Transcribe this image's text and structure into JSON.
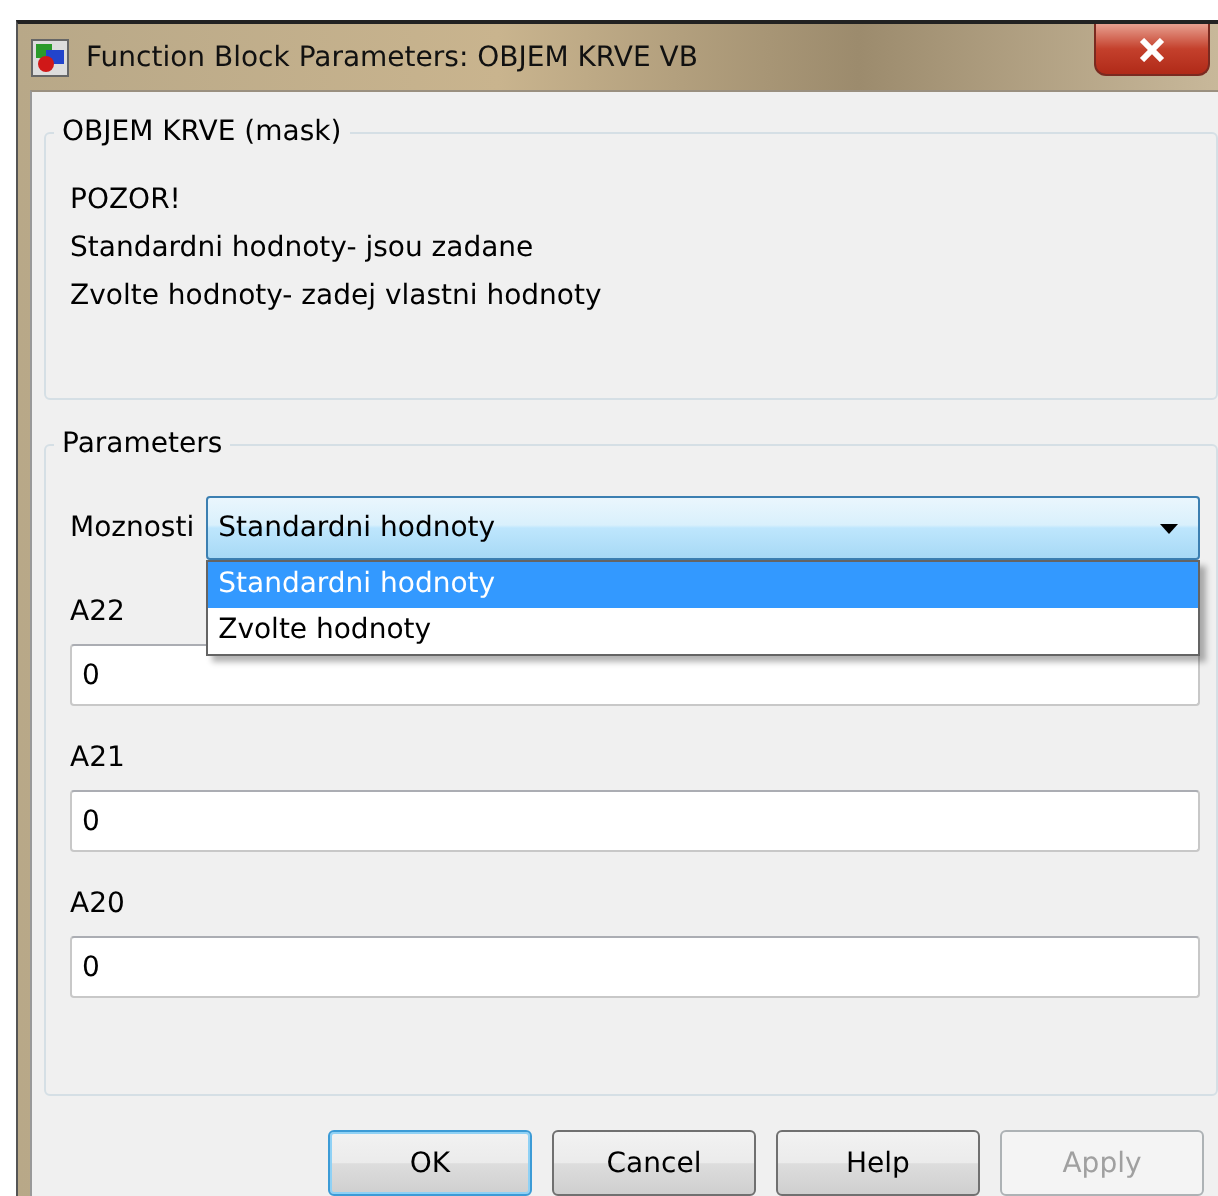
{
  "window": {
    "title": "Function Block Parameters: OBJEM KRVE VB"
  },
  "mask_group": {
    "title": "OBJEM KRVE (mask)",
    "lines": [
      "POZOR!",
      "Standardni hodnoty- jsou zadane",
      "Zvolte hodnoty- zadej vlastni hodnoty"
    ]
  },
  "parameters_group": {
    "title": "Parameters",
    "dropdown": {
      "label": "Moznosti",
      "value": "Standardni hodnoty",
      "expanded": true,
      "options": [
        {
          "label": "Standardni hodnoty",
          "selected": true
        },
        {
          "label": "Zvolte hodnoty",
          "selected": false
        }
      ]
    },
    "fields": [
      {
        "label": "A22",
        "value": "0"
      },
      {
        "label": "A21",
        "value": "0"
      },
      {
        "label": "A20",
        "value": "0"
      }
    ]
  },
  "buttons": [
    {
      "label": "OK",
      "default": true,
      "disabled": false
    },
    {
      "label": "Cancel",
      "default": false,
      "disabled": false
    },
    {
      "label": "Help",
      "default": false,
      "disabled": false
    },
    {
      "label": "Apply",
      "default": false,
      "disabled": true
    }
  ]
}
